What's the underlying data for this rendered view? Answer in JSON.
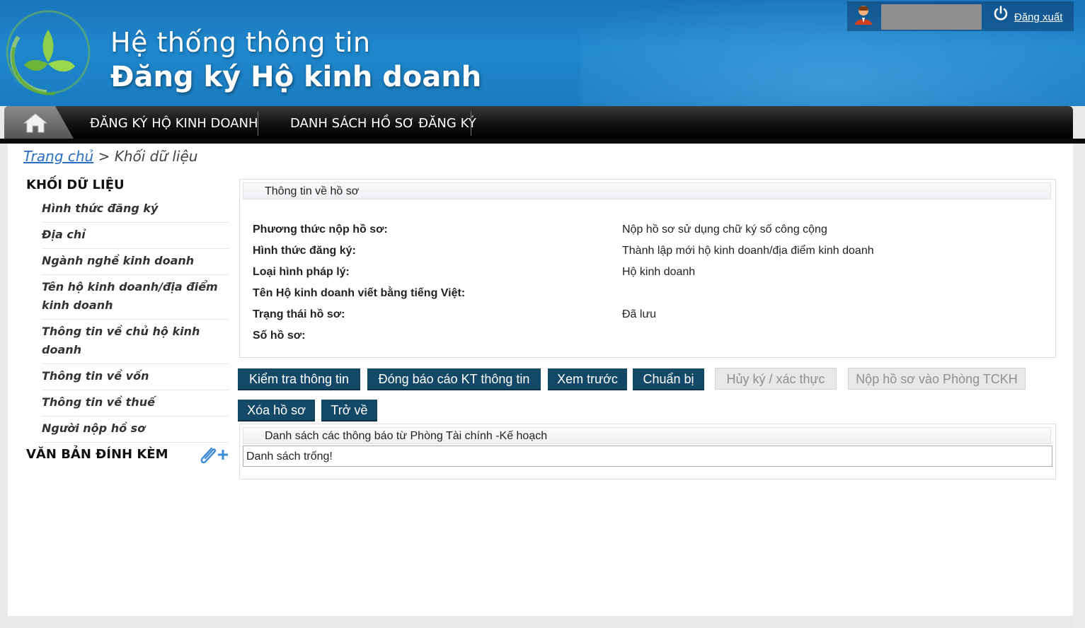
{
  "header": {
    "title_line1": "Hệ thống thông tin",
    "title_line2": "Đăng ký Hộ kinh doanh",
    "logout_label": "Đăng xuất"
  },
  "nav": {
    "items": [
      "ĐĂNG KÝ HỘ KINH DOANH",
      "DANH SÁCH HỒ SƠ ĐĂNG KÝ"
    ]
  },
  "breadcrumb": {
    "home": "Trang chủ",
    "separator": ">",
    "current": "Khối dữ liệu"
  },
  "sidebar": {
    "heading": "KHỐI DỮ LIỆU",
    "items": [
      "Hình thức đăng ký",
      "Địa chỉ",
      "Ngành nghề kinh doanh",
      "Tên hộ kinh doanh/địa điểm kinh doanh",
      "Thông tin về chủ hộ kinh doanh",
      "Thông tin về vốn",
      "Thông tin về thuế",
      "Người nộp hồ sơ"
    ],
    "attachments_heading": "VĂN BẢN ĐÍNH KÈM"
  },
  "dossier": {
    "heading": "Thông tin về hồ sơ",
    "rows": [
      {
        "label": "Phương thức nộp hồ sơ:",
        "value": "Nộp hồ sơ sử dụng chữ ký số công cộng"
      },
      {
        "label": "Hình thức đăng ký:",
        "value": "Thành lập mới hộ kinh doanh/địa điểm kinh doanh"
      },
      {
        "label": "Loại hình pháp lý:",
        "value": "Hộ kinh doanh"
      },
      {
        "label": "Tên Hộ kinh doanh viết bằng tiếng Việt:",
        "value": ""
      },
      {
        "label": "Trạng thái hồ sơ:",
        "value": "Đã lưu"
      },
      {
        "label": "Số hồ sơ:",
        "value": ""
      }
    ]
  },
  "buttons": {
    "check": "Kiểm tra thông tin",
    "report": "Đóng báo cáo KT thông tin",
    "preview": "Xem trước",
    "prepare": "Chuẩn bị",
    "cancel_sign": "Hủy ký / xác thực",
    "submit": "Nộp hồ sơ vào Phòng TCKH",
    "delete": "Xóa hồ sơ",
    "back": "Trở về"
  },
  "notices": {
    "heading": "Danh sách các thông báo từ Phòng Tài chính -Kế hoạch",
    "empty_text": "Danh sách trống!"
  },
  "colors": {
    "header_blue": "#1f87cc",
    "button_dark": "#134866",
    "link_blue": "#2b6fc2"
  }
}
